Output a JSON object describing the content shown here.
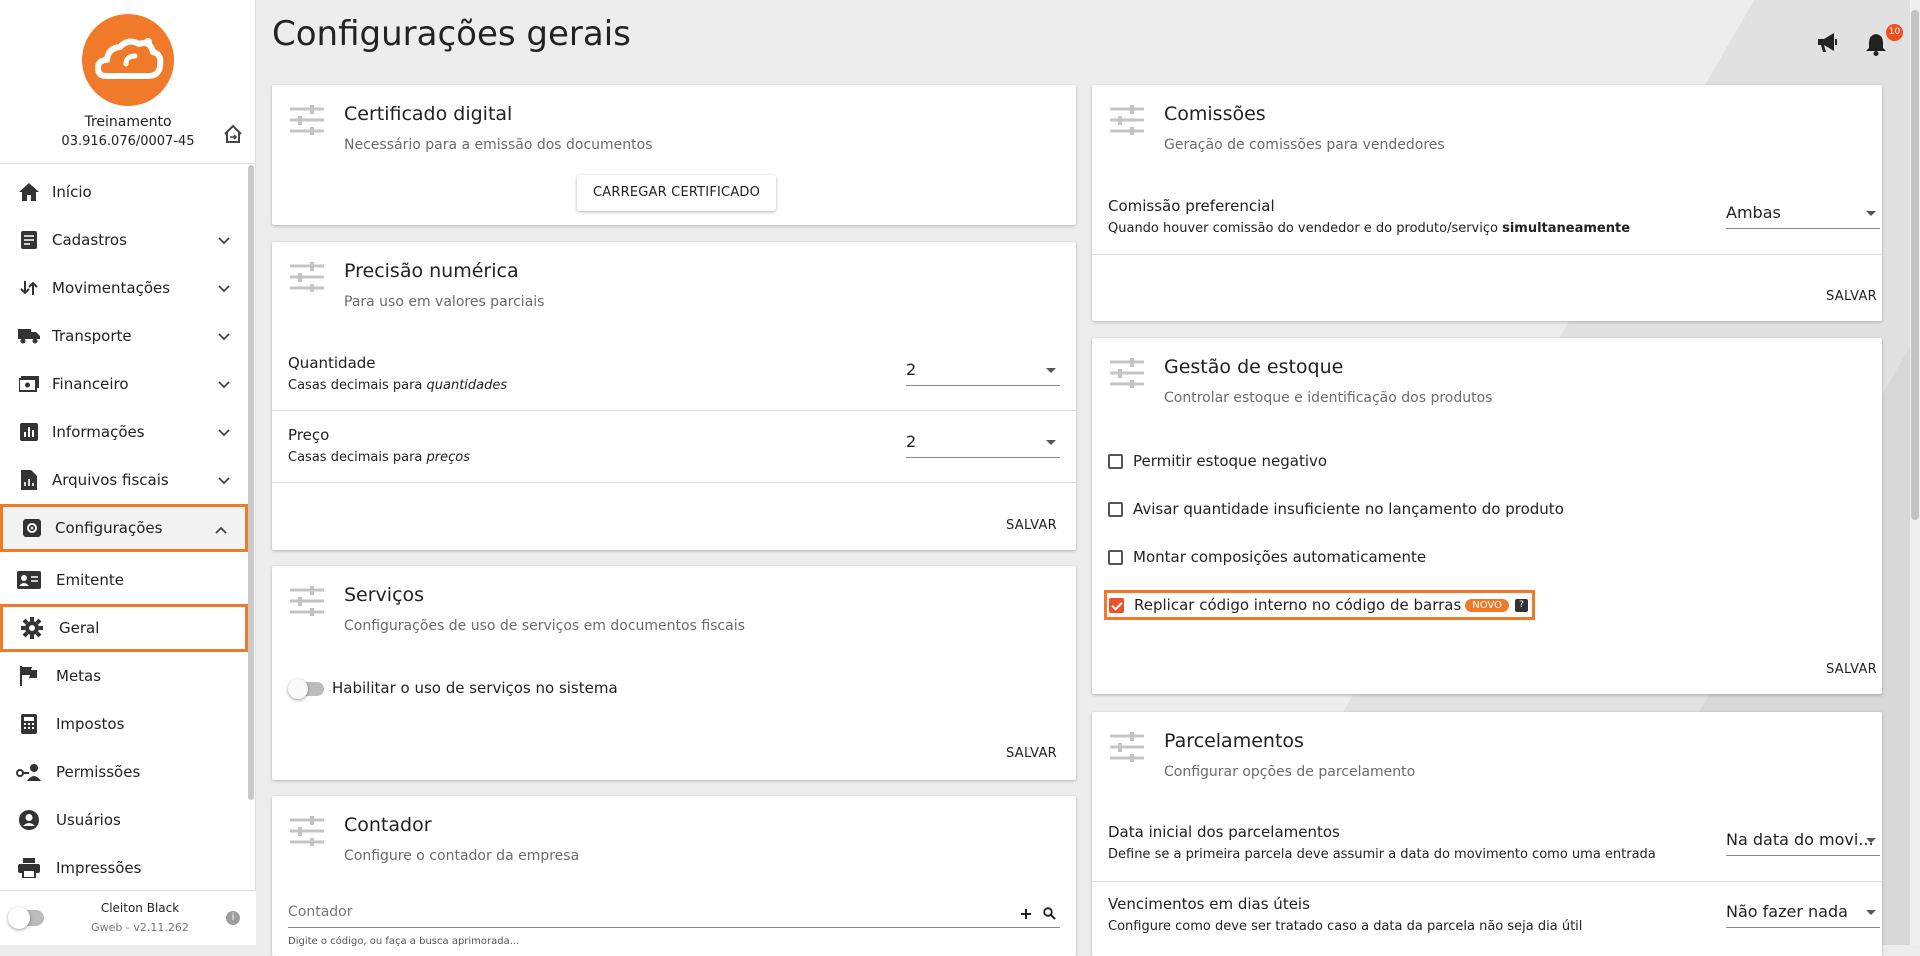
{
  "company": {
    "name": "Treinamento",
    "cnpj": "03.916.076/0007-45"
  },
  "nav": {
    "items": [
      {
        "label": "Início"
      },
      {
        "label": "Cadastros"
      },
      {
        "label": "Movimentações"
      },
      {
        "label": "Transporte"
      },
      {
        "label": "Financeiro"
      },
      {
        "label": "Informações"
      },
      {
        "label": "Arquivos fiscais"
      },
      {
        "label": "Configurações"
      }
    ],
    "sub_items": [
      {
        "label": "Emitente"
      },
      {
        "label": "Geral"
      },
      {
        "label": "Metas"
      },
      {
        "label": "Impostos"
      },
      {
        "label": "Permissões"
      },
      {
        "label": "Usuários"
      },
      {
        "label": "Impressões"
      }
    ]
  },
  "footer": {
    "user": "Cleiton Black",
    "version": "Gweb - v2.11.262"
  },
  "page": {
    "title": "Configurações gerais",
    "notification_count": "10"
  },
  "certificado": {
    "title": "Certificado digital",
    "subtitle": "Necessário para a emissão dos documentos",
    "button": "CARREGAR CERTIFICADO"
  },
  "precisao": {
    "title": "Precisão numérica",
    "subtitle": "Para uso em valores parciais",
    "quantidade_label": "Quantidade",
    "quantidade_desc_prefix": "Casas decimais para ",
    "quantidade_desc_em": "quantidades",
    "quantidade_value": "2",
    "preco_label": "Preço",
    "preco_desc_prefix": "Casas decimais para ",
    "preco_desc_em": "preços",
    "preco_value": "2",
    "save": "SALVAR"
  },
  "servicos": {
    "title": "Serviços",
    "subtitle": "Configurações de uso de serviços em documentos fiscais",
    "toggle_label": "Habilitar o uso de serviços no sistema",
    "toggle_on": false,
    "save": "SALVAR"
  },
  "contador": {
    "title": "Contador",
    "subtitle": "Configure o contador da empresa",
    "placeholder": "Contador",
    "helper": "Digite o código, ou faça a busca aprimorada..."
  },
  "comissoes": {
    "title": "Comissões",
    "subtitle": "Geração de comissões para vendedores",
    "row_label": "Comissão preferencial",
    "row_desc_prefix": "Quando houver comissão do vendedor e do produto/serviço ",
    "row_desc_bold": "simultaneamente",
    "select_value": "Ambas",
    "save": "SALVAR"
  },
  "estoque": {
    "title": "Gestão de estoque",
    "subtitle": "Controlar estoque e identificação dos produtos",
    "options": [
      {
        "label": "Permitir estoque negativo",
        "checked": false
      },
      {
        "label": "Avisar quantidade insuficiente no lançamento do produto",
        "checked": false
      },
      {
        "label": "Montar composições automaticamente",
        "checked": false
      },
      {
        "label": "Replicar código interno no código de barras",
        "checked": true
      }
    ],
    "badge": "NOVO",
    "save": "SALVAR"
  },
  "parcelamentos": {
    "title": "Parcelamentos",
    "subtitle": "Configurar opções de parcelamento",
    "data_label": "Data inicial dos parcelamentos",
    "data_desc": "Define se a primeira parcela deve assumir a data do movimento como uma entrada",
    "data_value": "Na data do movi...",
    "venc_label": "Vencimentos em dias úteis",
    "venc_desc": "Configure como deve ser tratado caso a data da parcela não seja dia útil",
    "venc_value": "Não fazer nada"
  },
  "colors": {
    "accent": "#f07a2a",
    "badge": "#f04e1d"
  }
}
